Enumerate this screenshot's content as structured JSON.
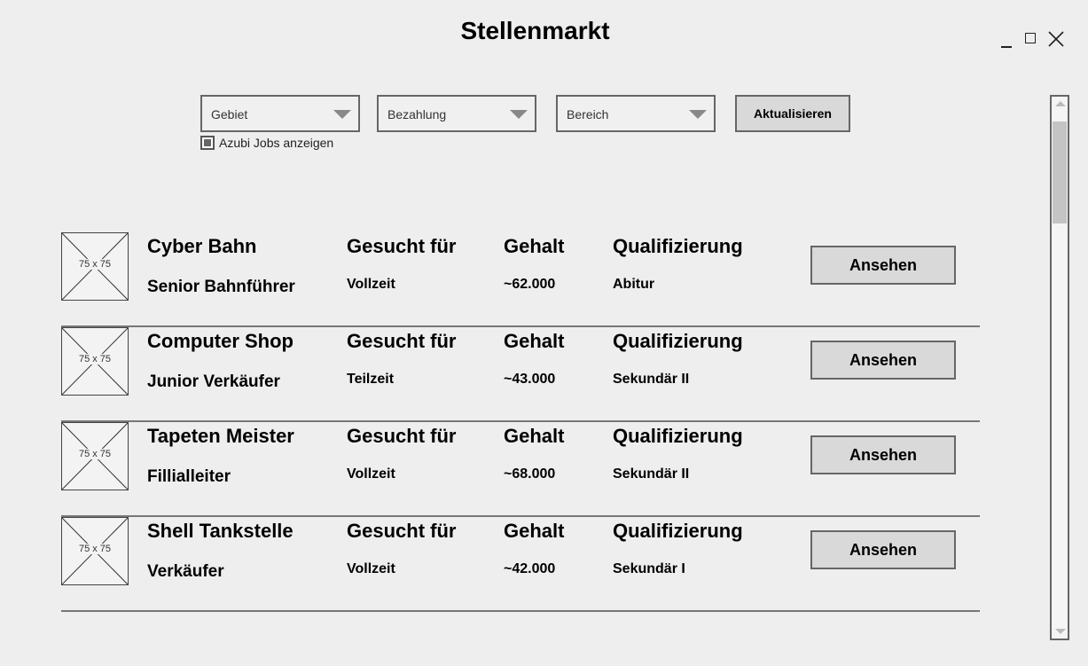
{
  "window": {
    "title": "Stellenmarkt",
    "controls": [
      "minimize-icon",
      "maximize-icon",
      "close-icon"
    ]
  },
  "filters": {
    "area": {
      "value": "Gebiet"
    },
    "payment": {
      "value": "Bezahlung"
    },
    "sector": {
      "value": "Bereich"
    },
    "refresh_label": "Aktualisieren",
    "apprentice_label": "Azubi Jobs anzeigen",
    "apprentice_checked": true
  },
  "columns": {
    "wanted_for": "Gesucht für",
    "salary": "Gehalt",
    "qualification": "Qualifizierung"
  },
  "jobs": [
    {
      "image": "75 x 75",
      "company": "Cyber Bahn",
      "position": "Senior Bahnführer",
      "wanted_for": "Vollzeit",
      "salary": "~62.000",
      "qualification": "Abitur",
      "button": "Ansehen"
    },
    {
      "image": "75 x 75",
      "company": "Computer Shop",
      "position": "Junior Verkäufer",
      "wanted_for": "Teilzeit",
      "salary": "~43.000",
      "qualification": "Sekundär II",
      "button": "Ansehen"
    },
    {
      "image": "75 x 75",
      "company": "Tapeten Meister",
      "position": "Fillialleiter",
      "wanted_for": "Vollzeit",
      "salary": "~68.000",
      "qualification": "Sekundär II",
      "button": "Ansehen"
    },
    {
      "image": "75 x 75",
      "company": "Shell Tankstelle",
      "position": "Verkäufer",
      "wanted_for": "Vollzeit",
      "salary": "~42.000",
      "qualification": "Sekundär I",
      "button": "Ansehen"
    }
  ],
  "colors": {
    "background": "#eeeeee",
    "button": "#d9d9d9",
    "border": "#666666"
  }
}
